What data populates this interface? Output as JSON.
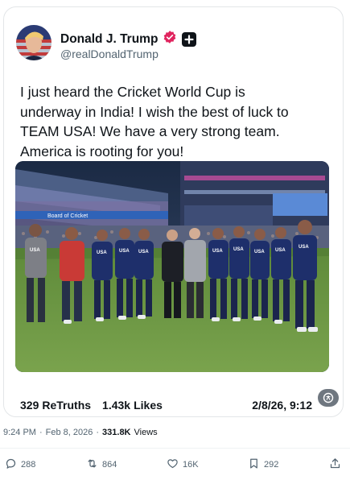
{
  "post": {
    "display_name": "Donald J. Trump",
    "handle": "@realDonaldTrump",
    "text": "I just heard the Cricket World Cup is\nunderway in India! I wish the best of luck to\nTEAM USA! We have a very strong team.\nAmerica is rooting for you!",
    "retruths_count": "329",
    "retruths_label": "ReTruths",
    "likes_count": "1.43k",
    "likes_label": "Likes",
    "date_short": "2/8/26, 9:12",
    "verified_color": "#e0245e"
  },
  "photo": {
    "stadium_board_text": "Board of Cricket",
    "jersey_text": "USA"
  },
  "tweet_meta": {
    "time": "9:24 PM",
    "separator_1": "·",
    "date": "Feb 8, 2026",
    "separator_2": "·",
    "views_count": "331.8K",
    "views_label": "Views"
  },
  "actions": {
    "replies": "288",
    "reposts": "864",
    "likes": "16K",
    "bookmarks": "292"
  },
  "icons": {
    "reply": "reply-icon",
    "repost": "repost-icon",
    "like": "heart-icon",
    "bookmark": "bookmark-icon",
    "share": "share-icon",
    "translate": "translate-icon",
    "verified": "verified-icon",
    "plus": "plus-icon"
  }
}
